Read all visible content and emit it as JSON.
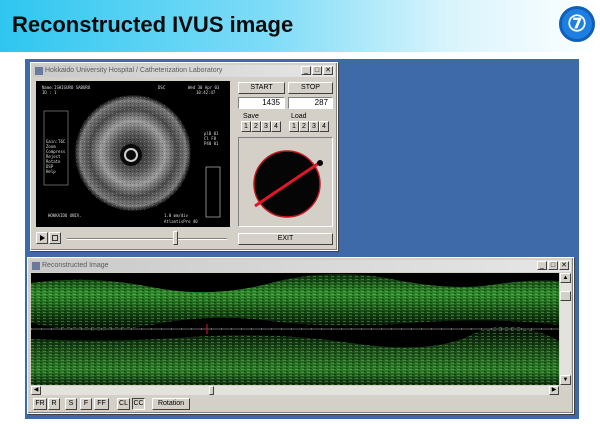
{
  "slide": {
    "title": "Reconstructed IVUS image",
    "number": "⑦"
  },
  "window_main": {
    "title": "Hokkaido University Hospital / Catheterization Laboratory",
    "controls": {
      "minimize": "_",
      "maximize": "□",
      "close": "✕"
    },
    "start_label": "START",
    "stop_label": "STOP",
    "start_value": "1435",
    "stop_value": "287",
    "save_label": "Save",
    "load_label": "Load",
    "save_slots": [
      "1",
      "2",
      "3",
      "4"
    ],
    "load_slots": [
      "1",
      "2",
      "3",
      "4"
    ],
    "exit_label": "EXIT",
    "play_icon": "play-icon",
    "stop_icon": "film-icon",
    "ivus": {
      "name_line": "Name:ISHIGURO SABURO",
      "id_line": "ID :  1",
      "date_line": "Wed 30 Apr 03",
      "time_line": "10:42:47",
      "dsc": "DSC",
      "menu": [
        "Gain:T6C",
        "Zoom",
        "Compress",
        "Reject",
        "Rotate",
        "DSP",
        "Help"
      ],
      "right_vals": [
        "plB 01",
        "Cl F8",
        "P40 01"
      ],
      "scale": "1.0 mm/div",
      "device": "AtlantisPro 40",
      "footer": "HOKKAIDO UNIV."
    },
    "accent": "#e0162b"
  },
  "window_recon": {
    "title": "Reconstructed Image",
    "controls": {
      "minimize": "_",
      "maximize": "□",
      "close": "✕"
    },
    "buttons": [
      "FR",
      "R",
      "S",
      "F",
      "FF",
      "CL",
      "CC",
      "Rotation"
    ]
  }
}
